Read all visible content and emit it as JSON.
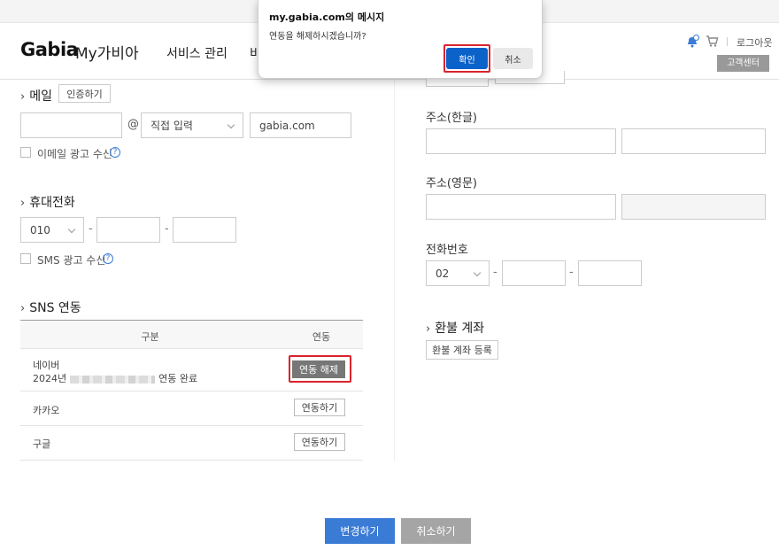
{
  "header": {
    "logo": "Gabia",
    "logo_sub": "My가비아",
    "nav": [
      "서비스 관리",
      "비"
    ],
    "logout": "로그아웃",
    "customer_center": "고객센터",
    "bell_badge": "N"
  },
  "email": {
    "title": "메일",
    "verify_button": "인증하기",
    "at": "@",
    "domain_select": "직접 입력",
    "domain_value": "gabia.com",
    "ad_consent": "이메일 광고 수신",
    "help": "?"
  },
  "mobile": {
    "title": "휴대전화",
    "prefix": "010",
    "dash": "-",
    "sms_consent": "SMS 광고 수신",
    "help": "?"
  },
  "sns": {
    "title": "SNS 연동",
    "col_type": "구분",
    "col_link": "연동",
    "rows": [
      {
        "name": "네이버",
        "date_prefix": "2024년",
        "date_suffix": "연동 완료",
        "button": "연동 해제"
      },
      {
        "name": "카카오",
        "button": "연동하기"
      },
      {
        "name": "구글",
        "button": "연동하기"
      }
    ]
  },
  "right": {
    "address_kr_label": "주소(한글)",
    "address_en_label": "주소(영문)",
    "phone_label": "전화번호",
    "phone_prefix": "02",
    "dash": "-",
    "refund_title": "환불 계좌",
    "refund_button": "환불 계좌 등록"
  },
  "footer": {
    "save": "변경하기",
    "cancel": "취소하기"
  },
  "dialog": {
    "title": "my.gabia.com의 메시지",
    "message": "연동을 해제하시겠습니까?",
    "ok": "확인",
    "cancel": "취소"
  },
  "colors": {
    "primary": "#3a7bd5",
    "highlight": "#d9232d",
    "dialog_ok": "#0b62c9"
  }
}
